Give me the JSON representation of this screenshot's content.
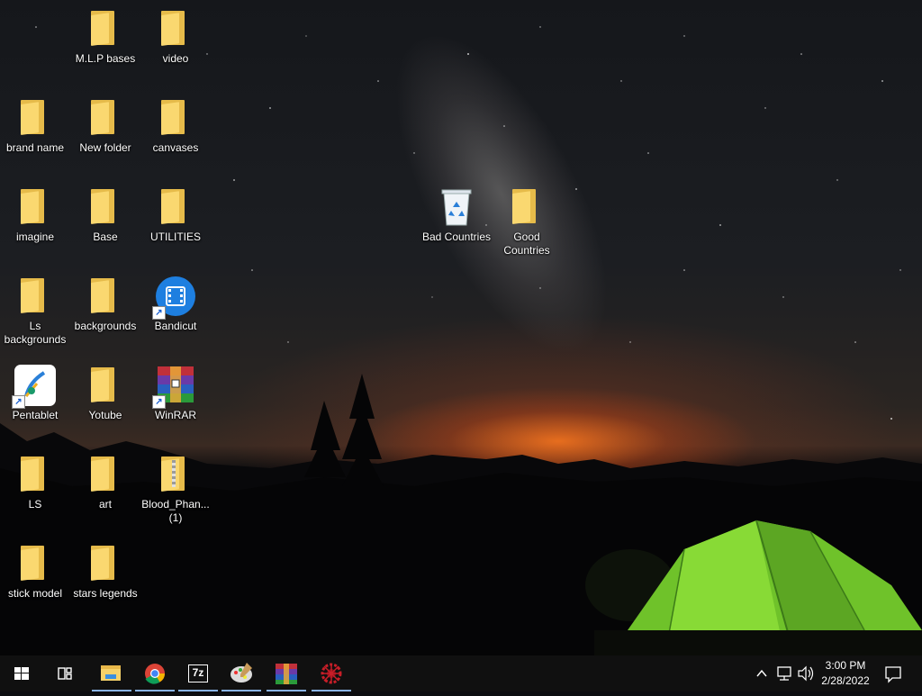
{
  "desktop": {
    "icons": [
      {
        "label": "M.L.P bases",
        "icon": "folder-icon"
      },
      {
        "label": "video",
        "icon": "folder-icon"
      },
      {
        "label": "brand name",
        "icon": "folder-icon"
      },
      {
        "label": "New folder",
        "icon": "folder-icon"
      },
      {
        "label": "canvases",
        "icon": "folder-icon"
      },
      {
        "label": "imagine",
        "icon": "folder-icon"
      },
      {
        "label": "Base",
        "icon": "folder-icon"
      },
      {
        "label": "UTILITIES",
        "icon": "folder-icon"
      },
      {
        "label": "Ls backgrounds",
        "icon": "folder-icon"
      },
      {
        "label": "backgrounds",
        "icon": "folder-icon"
      },
      {
        "label": "Bandicut",
        "icon": "bandicut-app-icon"
      },
      {
        "label": "Pentablet",
        "icon": "pentablet-app-icon"
      },
      {
        "label": "Yotube",
        "icon": "folder-icon"
      },
      {
        "label": "WinRAR",
        "icon": "winrar-app-icon"
      },
      {
        "label": "LS",
        "icon": "folder-icon"
      },
      {
        "label": "art",
        "icon": "folder-icon"
      },
      {
        "label": "Blood_Phan... (1)",
        "icon": "zipped-folder-icon"
      },
      {
        "label": "stick model",
        "icon": "folder-icon"
      },
      {
        "label": "stars legends",
        "icon": "folder-icon"
      },
      {
        "label": "Bad Countries",
        "icon": "recycle-bin-icon"
      },
      {
        "label": "Good Countries",
        "icon": "folder-icon"
      }
    ]
  },
  "taskbar": {
    "start": "windows-start-icon",
    "task_view": "task-view-icon",
    "pinned": [
      {
        "name": "file-explorer",
        "icon": "file-explorer-icon",
        "active": true
      },
      {
        "name": "chrome",
        "icon": "chrome-icon",
        "active": true
      },
      {
        "name": "7zip",
        "icon": "7zip-icon",
        "label": "7z",
        "active": true
      },
      {
        "name": "paint",
        "icon": "paint-palette-icon",
        "active": true
      },
      {
        "name": "winrar",
        "icon": "winrar-icon",
        "active": true
      },
      {
        "name": "red-app",
        "icon": "red-gear-icon",
        "active": true
      }
    ],
    "tray": {
      "icons": [
        "chevron-up-icon",
        "network-icon",
        "volume-icon"
      ],
      "time": "3:00 PM",
      "date": "2/28/2022",
      "notification": "action-center-icon"
    }
  },
  "colors": {
    "taskbar_bg": "#101010",
    "folder": "#fad870",
    "active_underline": "#8ab4e8"
  }
}
